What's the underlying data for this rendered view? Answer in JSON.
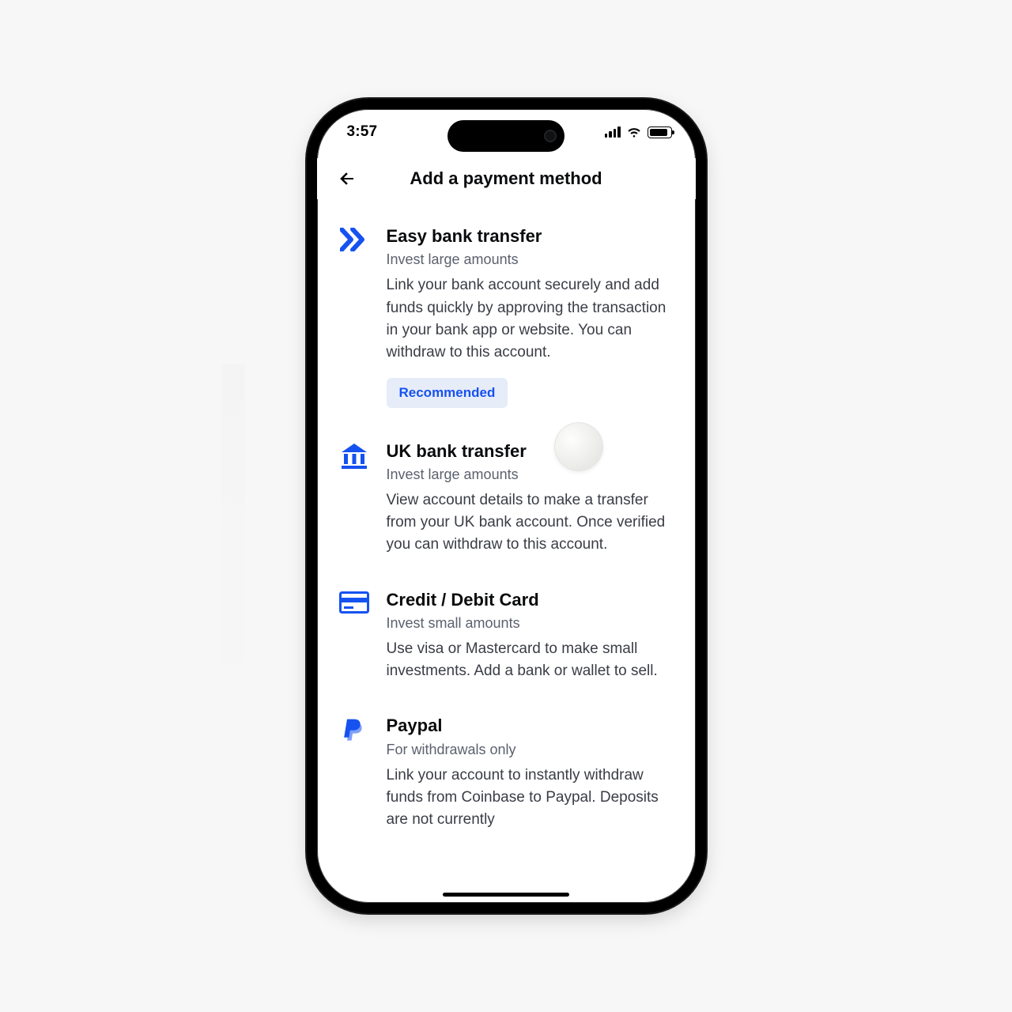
{
  "status": {
    "time": "3:57"
  },
  "header": {
    "title": "Add a payment method"
  },
  "methods": [
    {
      "id": "easy-bank",
      "icon": "chevrons-right-icon",
      "title": "Easy bank transfer",
      "subtitle": "Invest large amounts",
      "description": "Link your bank account securely and add funds quickly by approving the transaction in your bank app or website. You can withdraw to this account.",
      "badge": "Recommended"
    },
    {
      "id": "uk-bank",
      "icon": "bank-icon",
      "title": "UK bank transfer",
      "subtitle": "Invest large amounts",
      "description": "View account details to make a transfer from your UK bank account. Once verified you can withdraw to this account."
    },
    {
      "id": "card",
      "icon": "card-icon",
      "title": "Credit / Debit Card",
      "subtitle": "Invest small amounts",
      "description": "Use visa or Mastercard to make small investments. Add a bank or wallet to sell."
    },
    {
      "id": "paypal",
      "icon": "paypal-icon",
      "title": "Paypal",
      "subtitle": "For withdrawals only",
      "description": "Link your account to instantly withdraw funds from Coinbase to Paypal. Deposits are not currently"
    }
  ],
  "colors": {
    "brand": "#1652f0"
  }
}
